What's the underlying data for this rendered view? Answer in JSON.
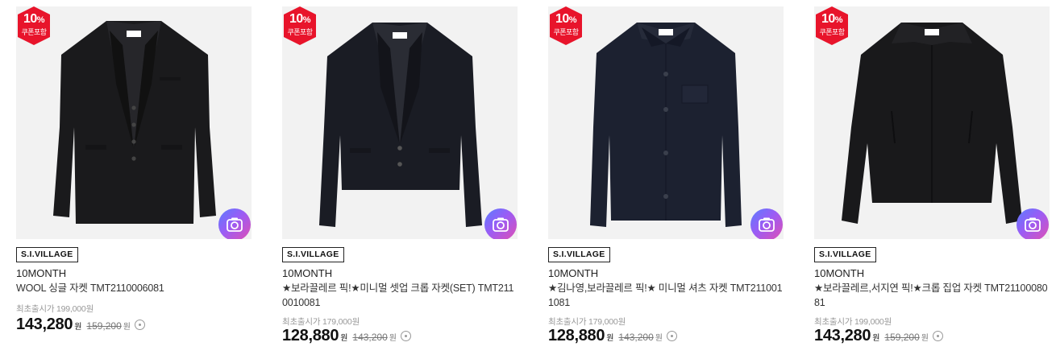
{
  "products": [
    {
      "coupon": {
        "percent": "10",
        "percent_sign": "%",
        "label": "쿠폰포함"
      },
      "store_tag": "S.I.VILLAGE",
      "brand": "10MONTH",
      "title": "WOOL 싱글 자켓 TMT2110006081",
      "original_label": "최초출시가 199,000원",
      "sale_price": "143,280",
      "sale_unit": "원",
      "list_price": "159,200",
      "list_unit": "원",
      "icons": [
        "coupon-badge-icon",
        "photo-review-camera-icon",
        "price-info-icon"
      ]
    },
    {
      "coupon": {
        "percent": "10",
        "percent_sign": "%",
        "label": "쿠폰포함"
      },
      "store_tag": "S.I.VILLAGE",
      "brand": "10MONTH",
      "title": "★보라끌레르 픽!★미니멀 셋업 크롭 자켓(SET) TMT2110010081",
      "original_label": "최초출시가 179,000원",
      "sale_price": "128,880",
      "sale_unit": "원",
      "list_price": "143,200",
      "list_unit": "원",
      "icons": [
        "coupon-badge-icon",
        "photo-review-camera-icon",
        "price-info-icon"
      ]
    },
    {
      "coupon": {
        "percent": "10",
        "percent_sign": "%",
        "label": "쿠폰포함"
      },
      "store_tag": "S.I.VILLAGE",
      "brand": "10MONTH",
      "title": "★김나영,보라끌레르 픽!★ 미니멀 셔츠 자켓 TMT2110011081",
      "original_label": "최초출시가 179,000원",
      "sale_price": "128,880",
      "sale_unit": "원",
      "list_price": "143,200",
      "list_unit": "원",
      "icons": [
        "coupon-badge-icon",
        "photo-review-camera-icon",
        "price-info-icon"
      ]
    },
    {
      "coupon": {
        "percent": "10",
        "percent_sign": "%",
        "label": "쿠폰포함"
      },
      "store_tag": "S.I.VILLAGE",
      "brand": "10MONTH",
      "title": "★보라끌레르,서지연 픽!★크롭 집업 자켓 TMT2110008081",
      "original_label": "최초출시가 199,000원",
      "sale_price": "143,280",
      "sale_unit": "원",
      "list_price": "159,200",
      "list_unit": "원",
      "icons": [
        "coupon-badge-icon",
        "photo-review-camera-icon",
        "price-info-icon"
      ]
    }
  ],
  "colors": {
    "coupon_red": "#e8142b",
    "jacket_black": "#1a1a1c",
    "jacket_navy": "#1c2130",
    "image_bg": "#f2f2f2"
  }
}
